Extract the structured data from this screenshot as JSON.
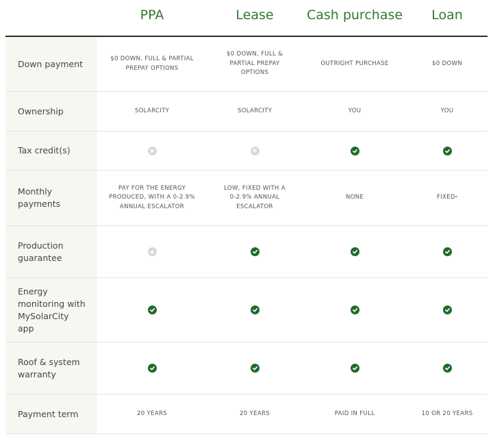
{
  "columns": [
    "PPA",
    "Lease",
    "Cash purchase",
    "Loan"
  ],
  "rows": [
    {
      "label": "Down payment",
      "cells": [
        {
          "type": "text",
          "text": "$0 DOWN, FULL & PARTIAL PREPAY OPTIONS"
        },
        {
          "type": "text",
          "text": "$0 DOWN, FULL & PARTIAL PREPAY OPTIONS"
        },
        {
          "type": "text",
          "text": "OUTRIGHT PURCHASE"
        },
        {
          "type": "text",
          "text": "$0 DOWN"
        }
      ]
    },
    {
      "label": "Ownership",
      "cells": [
        {
          "type": "text",
          "text": "SOLARCITY"
        },
        {
          "type": "text",
          "text": "SOLARCITY"
        },
        {
          "type": "text",
          "text": "YOU"
        },
        {
          "type": "text",
          "text": "YOU"
        }
      ]
    },
    {
      "label": "Tax credit(s)",
      "cells": [
        {
          "type": "icon",
          "icon": "x-icon"
        },
        {
          "type": "icon",
          "icon": "x-icon"
        },
        {
          "type": "icon",
          "icon": "check-icon"
        },
        {
          "type": "icon",
          "icon": "check-icon"
        }
      ]
    },
    {
      "label": "Monthly payments",
      "cells": [
        {
          "type": "text",
          "text": "PAY FOR THE ENERGY PRODUCED, WITH A 0-2.9% ANNUAL ESCALATOR"
        },
        {
          "type": "text",
          "text": "LOW, FIXED WITH A 0-2.9% ANNUAL ESCALATOR"
        },
        {
          "type": "text",
          "text": "NONE"
        },
        {
          "type": "text",
          "text": "FIXED",
          "sup": "*"
        }
      ]
    },
    {
      "label": "Production guarantee",
      "cells": [
        {
          "type": "icon",
          "icon": "x-icon"
        },
        {
          "type": "icon",
          "icon": "check-icon"
        },
        {
          "type": "icon",
          "icon": "check-icon"
        },
        {
          "type": "icon",
          "icon": "check-icon"
        }
      ]
    },
    {
      "label": "Energy monitoring with MySolarCity app",
      "cells": [
        {
          "type": "icon",
          "icon": "check-icon"
        },
        {
          "type": "icon",
          "icon": "check-icon"
        },
        {
          "type": "icon",
          "icon": "check-icon"
        },
        {
          "type": "icon",
          "icon": "check-icon"
        }
      ]
    },
    {
      "label": "Roof & system warranty",
      "cells": [
        {
          "type": "icon",
          "icon": "check-icon"
        },
        {
          "type": "icon",
          "icon": "check-icon"
        },
        {
          "type": "icon",
          "icon": "check-icon"
        },
        {
          "type": "icon",
          "icon": "check-icon"
        }
      ]
    },
    {
      "label": "Payment term",
      "cells": [
        {
          "type": "text",
          "text": "20 YEARS"
        },
        {
          "type": "text",
          "text": "20 YEARS"
        },
        {
          "type": "text",
          "text": "PAID IN FULL"
        },
        {
          "type": "text",
          "text": "10 OR 20 YEARS"
        }
      ]
    }
  ],
  "colors": {
    "header": "#2f7a2d",
    "check": "#1f6a2e",
    "x": "#d9d9d9",
    "label_bg": "#f7f7f2"
  }
}
